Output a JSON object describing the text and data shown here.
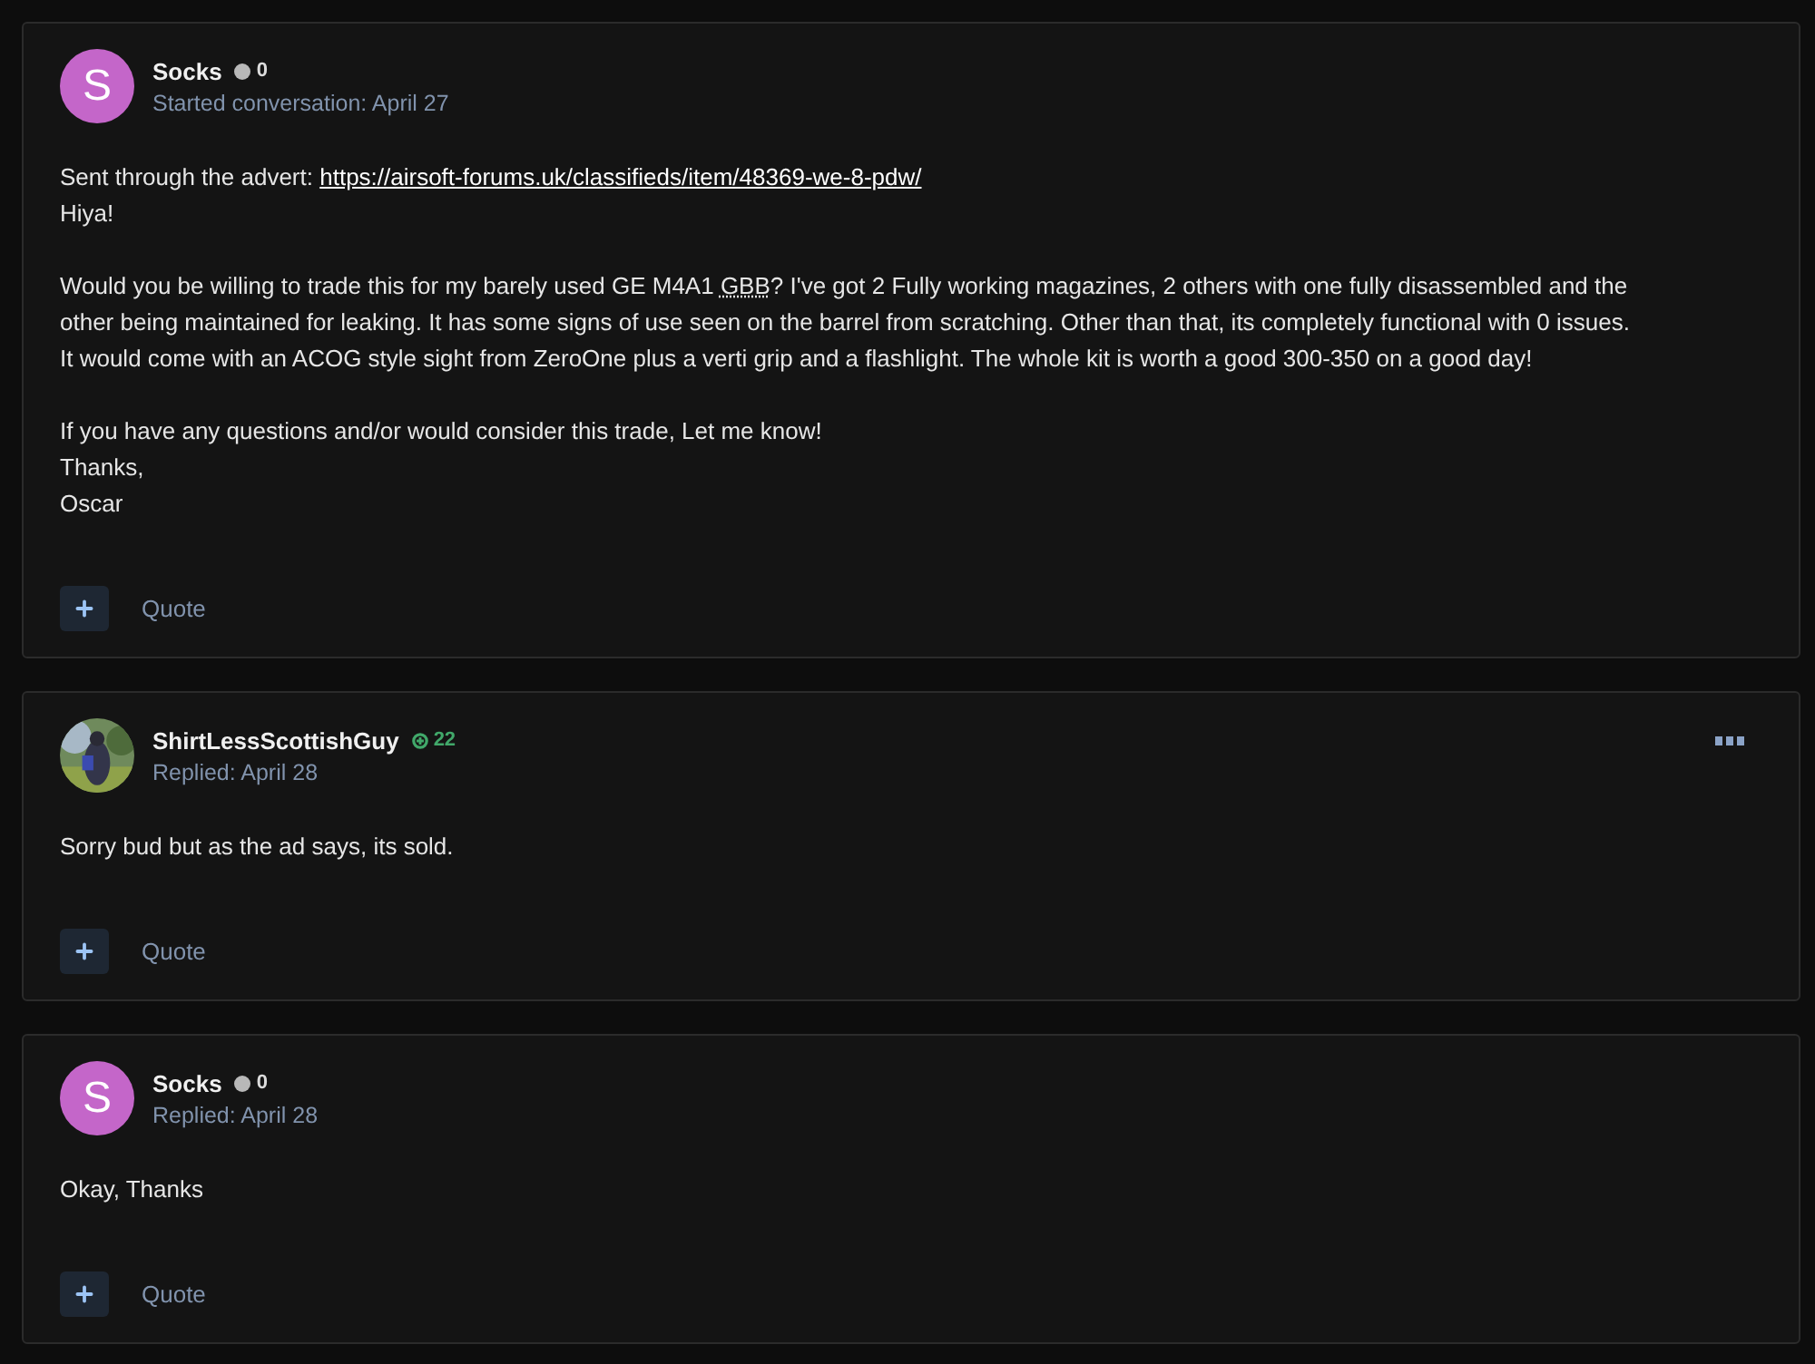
{
  "posts": [
    {
      "author": "Socks",
      "avatar": {
        "kind": "letter",
        "letter": "S",
        "color": "#c466c9"
      },
      "reputation": {
        "kind": "neutral",
        "count": "0"
      },
      "meta": "Started conversation: April 27",
      "menu": false,
      "paragraphs": [
        [
          [
            {
              "kind": "text",
              "text": "Sent through the advert: "
            },
            {
              "kind": "link",
              "text": "https://airsoft-forums.uk/classifieds/item/48369-we-8-pdw/"
            }
          ],
          [
            {
              "kind": "text",
              "text": "Hiya!"
            }
          ]
        ],
        [
          [
            {
              "kind": "text",
              "text": "Would you be willing to trade this for my barely used GE M4A1 "
            },
            {
              "kind": "abbr",
              "text": "GBB"
            },
            {
              "kind": "text",
              "text": "? I've got 2 Fully working magazines, 2 others with one fully disassembled and the"
            }
          ],
          [
            {
              "kind": "text",
              "text": "other being maintained for leaking. It has some signs of use seen on the barrel from scratching. Other than that, its completely functional with 0 issues."
            }
          ],
          [
            {
              "kind": "text",
              "text": "It would come with an ACOG style sight from ZeroOne plus a verti grip and a flashlight. The whole kit is worth a good 300-350 on a good day!"
            }
          ]
        ],
        [
          [
            {
              "kind": "text",
              "text": "If you have any questions and/or would consider this trade, Let me know!"
            }
          ],
          [
            {
              "kind": "text",
              "text": "Thanks,"
            }
          ],
          [
            {
              "kind": "text",
              "text": "Oscar"
            }
          ]
        ]
      ],
      "quote": "Quote"
    },
    {
      "author": "ShirtLessScottishGuy",
      "avatar": {
        "kind": "picture"
      },
      "reputation": {
        "kind": "positive",
        "count": "22"
      },
      "meta": "Replied: April 28",
      "menu": true,
      "paragraphs": [
        [
          [
            {
              "kind": "text",
              "text": "Sorry bud but as the ad says, its sold."
            }
          ]
        ]
      ],
      "quote": "Quote"
    },
    {
      "author": "Socks",
      "avatar": {
        "kind": "letter",
        "letter": "S",
        "color": "#c466c9"
      },
      "reputation": {
        "kind": "neutral",
        "count": "0"
      },
      "meta": "Replied: April 28",
      "menu": false,
      "paragraphs": [
        [
          [
            {
              "kind": "text",
              "text": "Okay, Thanks"
            }
          ]
        ]
      ],
      "quote": "Quote"
    }
  ]
}
